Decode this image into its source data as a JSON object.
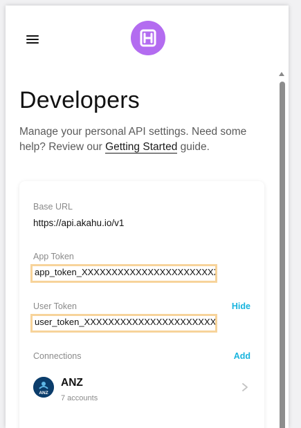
{
  "header": {
    "menu_icon": "hamburger-menu-icon",
    "logo_icon": "akahu-logo-icon",
    "logo_color": "#b36cf0"
  },
  "page": {
    "title": "Developers",
    "intro_before": "Manage your personal API settings. Need some help? Review our ",
    "intro_link": "Getting Started",
    "intro_after": " guide."
  },
  "settings": {
    "base_url_label": "Base URL",
    "base_url_value": "https://api.akahu.io/v1",
    "app_token_label": "App Token",
    "app_token_value": "app_token_XXXXXXXXXXXXXXXXXXXXXXXXXX",
    "user_token_label": "User Token",
    "user_token_action": "Hide",
    "user_token_value": "user_token_XXXXXXXXXXXXXXXXXXXXXXXXXX",
    "connections_label": "Connections",
    "connections_action": "Add",
    "highlight_color": "#f7d39a",
    "link_color": "#18b4de"
  },
  "connections": [
    {
      "name": "ANZ",
      "detail": "7 accounts",
      "logo_text": "ANZ",
      "logo_color": "#0b3d6b",
      "chevron_icon": "chevron-right-icon"
    }
  ]
}
